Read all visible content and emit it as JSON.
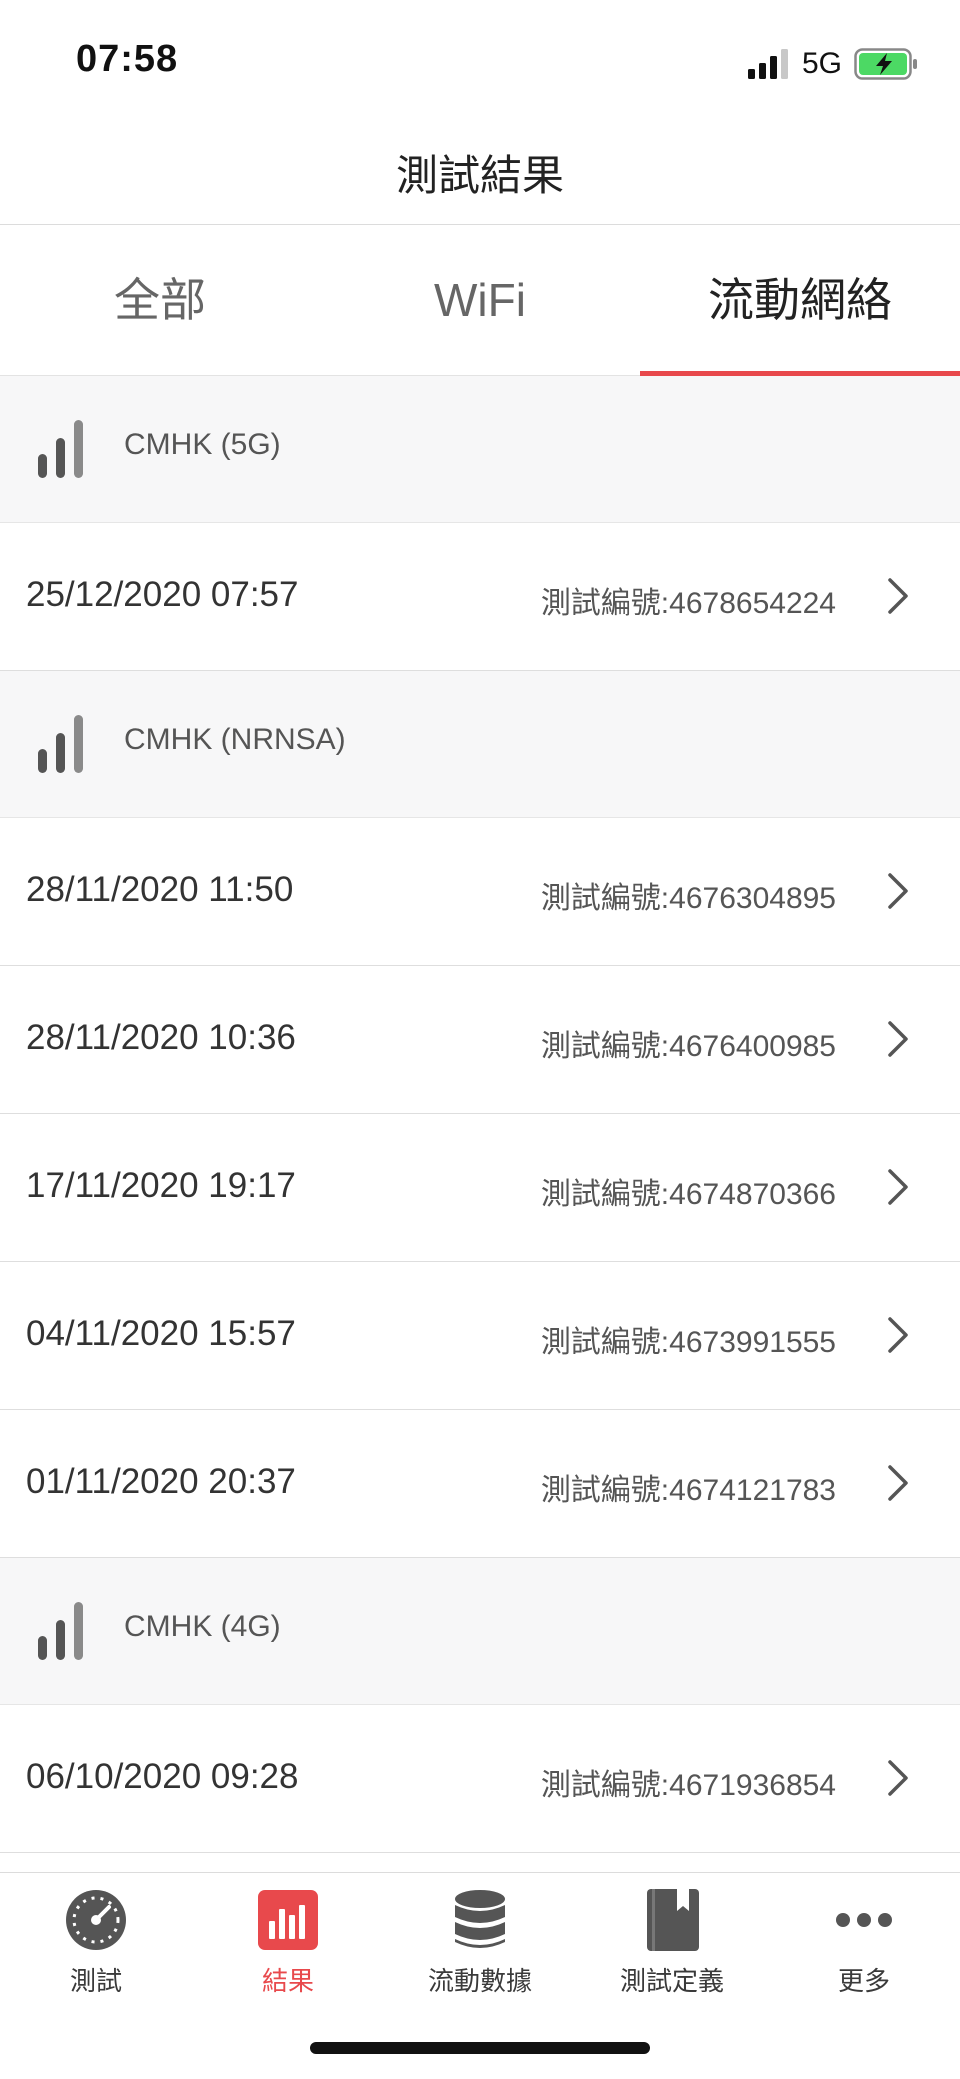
{
  "status_bar": {
    "time": "07:58",
    "network": "5G"
  },
  "header": {
    "title": "測試結果"
  },
  "tabs": [
    {
      "label": "全部",
      "active": false
    },
    {
      "label": "WiFi",
      "active": false
    },
    {
      "label": "流動網絡",
      "active": true
    }
  ],
  "groups": [
    {
      "label": "CMHK (5G)",
      "icon": "cellular-signal-icon",
      "rows": [
        {
          "date": "25/12/2020 07:57",
          "id": "測試編號:4678654224"
        }
      ]
    },
    {
      "label": "CMHK (NRNSA)",
      "icon": "cellular-signal-icon",
      "rows": [
        {
          "date": "28/11/2020 11:50",
          "id": "測試編號:4676304895"
        },
        {
          "date": "28/11/2020 10:36",
          "id": "測試編號:4676400985"
        },
        {
          "date": "17/11/2020 19:17",
          "id": "測試編號:4674870366"
        },
        {
          "date": "04/11/2020 15:57",
          "id": "測試編號:4673991555"
        },
        {
          "date": "01/11/2020 20:37",
          "id": "測試編號:4674121783"
        }
      ]
    },
    {
      "label": "CMHK (4G)",
      "icon": "cellular-signal-icon",
      "rows": [
        {
          "date": "06/10/2020 09:28",
          "id": "測試編號:4671936854"
        }
      ]
    }
  ],
  "tab_bar": {
    "items": [
      {
        "label": "測試",
        "icon": "speedometer-icon",
        "active": false
      },
      {
        "label": "結果",
        "icon": "results-chart-icon",
        "active": true
      },
      {
        "label": "流動數據",
        "icon": "database-icon",
        "active": false
      },
      {
        "label": "測試定義",
        "icon": "book-icon",
        "active": false
      },
      {
        "label": "更多",
        "icon": "more-dots-icon",
        "active": false
      }
    ]
  },
  "colors": {
    "accent": "#e8494c",
    "group_bg": "#f7f7f8",
    "icon_gray": "#555555"
  }
}
